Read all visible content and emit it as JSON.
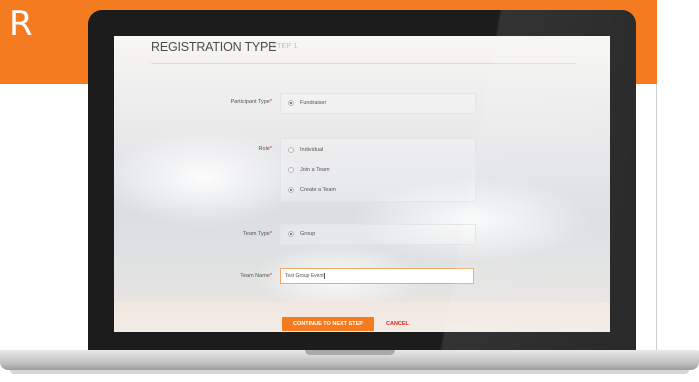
{
  "slide": {
    "letter": "R"
  },
  "form": {
    "title": "REGISTRATION TYPE",
    "step": "STEP 1",
    "participant_type": {
      "label": "Participant Type",
      "required_mark": "*",
      "options": [
        {
          "label": "Fundraiser",
          "checked": true
        }
      ]
    },
    "role": {
      "label": "Role",
      "required_mark": "*",
      "options": [
        {
          "label": "Individual",
          "checked": false
        },
        {
          "label": "Join a Team",
          "checked": false
        },
        {
          "label": "Create a Team",
          "checked": true
        }
      ]
    },
    "team_type": {
      "label": "Team Type",
      "required_mark": "*",
      "options": [
        {
          "label": "Group",
          "checked": true
        }
      ]
    },
    "team_name": {
      "label": "Team Name",
      "required_mark": "*",
      "value": "Test Group Event"
    },
    "continue_label": "CONTINUE TO NEXT STEP",
    "cancel_label": "CANCEL"
  },
  "colors": {
    "accent": "#f47b20",
    "required": "#e2231a",
    "bezel": "#1c1c1c"
  }
}
